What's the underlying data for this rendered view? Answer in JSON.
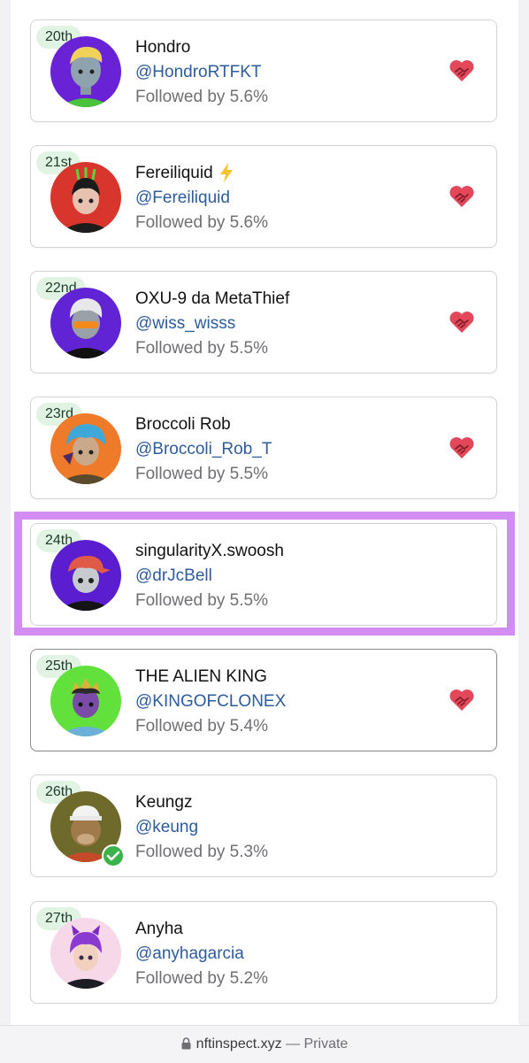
{
  "colors": {
    "rank_bg": "#e1f3e3",
    "handle": "#2d5b9b",
    "highlight": "#d38cf2",
    "follow_icon": "#e2475a"
  },
  "items": [
    {
      "rank": "20th",
      "name": "Hondro",
      "handle": "@HondroRTFKT",
      "followed": "Followed by 5.6%",
      "avatar": "hondro-avatar",
      "follow_icon": "handshake-heart-icon"
    },
    {
      "rank": "21st",
      "name": "Fereiliquid",
      "emoji": "⚡",
      "handle": "@Fereiliquid",
      "followed": "Followed by 5.6%",
      "avatar": "fereiliquid-avatar",
      "follow_icon": "handshake-heart-icon"
    },
    {
      "rank": "22nd",
      "name": "OXU-9 da MetaThief",
      "handle": "@wiss_wisss",
      "followed": "Followed by 5.5%",
      "avatar": "oxu9-avatar",
      "follow_icon": "handshake-heart-icon"
    },
    {
      "rank": "23rd",
      "name": "Broccoli Rob",
      "handle": "@Broccoli_Rob_T",
      "followed": "Followed by 5.5%",
      "avatar": "broccoli-rob-avatar",
      "follow_icon": "handshake-heart-icon"
    },
    {
      "rank": "24th",
      "name": "singularityX.swoosh",
      "handle": "@drJcBell",
      "followed": "Followed by 5.5%",
      "avatar": "singularityx-avatar",
      "highlighted": true
    },
    {
      "rank": "25th",
      "name": "THE ALIEN KING",
      "handle": "@KINGOFCLONEX",
      "followed": "Followed by 5.4%",
      "avatar": "alien-king-avatar",
      "follow_icon": "handshake-heart-icon"
    },
    {
      "rank": "26th",
      "name": "Keungz",
      "handle": "@keung",
      "followed": "Followed by 5.3%",
      "avatar": "keungz-avatar",
      "verified": true
    },
    {
      "rank": "27th",
      "name": "Anyha",
      "handle": "@anyhagarcia",
      "followed": "Followed by 5.2%",
      "avatar": "anyha-avatar"
    }
  ],
  "browser": {
    "url": "nftinspect.xyz",
    "suffix": "— Private",
    "lock_icon": "lock-icon"
  }
}
